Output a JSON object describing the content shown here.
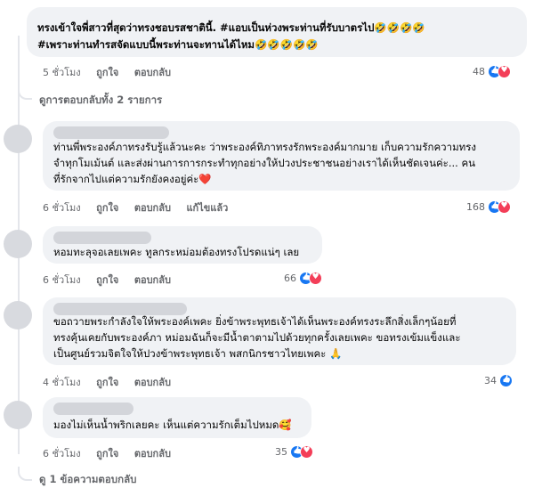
{
  "comments": [
    {
      "lines": [
        "ทรงเข้าใจพี่สาวที่สุดว่าทรงชอบรสชาตินี้. #แอบเป็นห่วงพระท่านที่รับบาตรไป🤣🤣🤣🤣",
        "#เพราะท่านทำรสจัดแบบนี้พระท่านจะทานได้ไหม🤣🤣🤣🤣🤣"
      ],
      "time": "5 ชั่วโมง",
      "like": "ถูกใจ",
      "reply": "ตอบกลับ",
      "edited": "",
      "reactions": "48"
    },
    {
      "lines": [
        "ท่านพี่พระองค์ภาทรงรับรู้แล้วนะคะ ว่าพระองค์ทิภาทรงรักพระองค์มากมาย เก็บความรักความทรง",
        "จำทุกโมเม้นต์ และส่งผ่านการการกระทำทุกอย่างให้ปวงประชาชนอย่างเราได้เห็นชัดเจนค่ะ... คน",
        "ที่รักจากไปแต่ความรักยังคงอยู่ค่ะ❤️"
      ],
      "time": "6 ชั่วโมง",
      "like": "ถูกใจ",
      "reply": "ตอบกลับ",
      "edited": "แก้ไขแล้ว",
      "reactions": "168"
    },
    {
      "lines": [
        "หอมทะลุจอเลยเพคะ ทูลกระหม่อมต้องทรงโปรดแน่ๆ เลย"
      ],
      "time": "6 ชั่วโมง",
      "like": "ถูกใจ",
      "reply": "ตอบกลับ",
      "edited": "",
      "reactions": "66"
    },
    {
      "lines": [
        "ขอถวายพระกำลังใจให้พระองค์เพคะ ยิ่งข้าพระพุทธเจ้าได้เห็นพระองค์ทรงระลึกสิ่งเล็กๆน้อยที่",
        "ทรงคุ้นเคยกับพระองค์ภา หม่อมฉันก็จะมีน้ำตาตามไปด้วยทุกครั้งเลยเพคะ ขอทรงเข้มแข็งและ",
        "เป็นศูนย์รวมจิตใจให้ปวงข้าพระพุทธเจ้า พสกนิกรชาวไทยเพคะ 🙏"
      ],
      "time": "4 ชั่วโมง",
      "like": "ถูกใจ",
      "reply": "ตอบกลับ",
      "edited": "",
      "reactions": "34"
    },
    {
      "lines": [
        "มองไม่เห็นน้ำพริกเลยคะ เห็นแต่ความรักเต็มไปหมด🥰"
      ],
      "time": "6 ชั่วโมง",
      "like": "ถูกใจ",
      "reply": "ตอบกลับ",
      "edited": "",
      "reactions": "35"
    }
  ],
  "view_replies_1": "ดูการตอบกลับทั้ง 2 รายการ",
  "view_replies_2": "ดู 1 ข้อความตอบกลับ"
}
